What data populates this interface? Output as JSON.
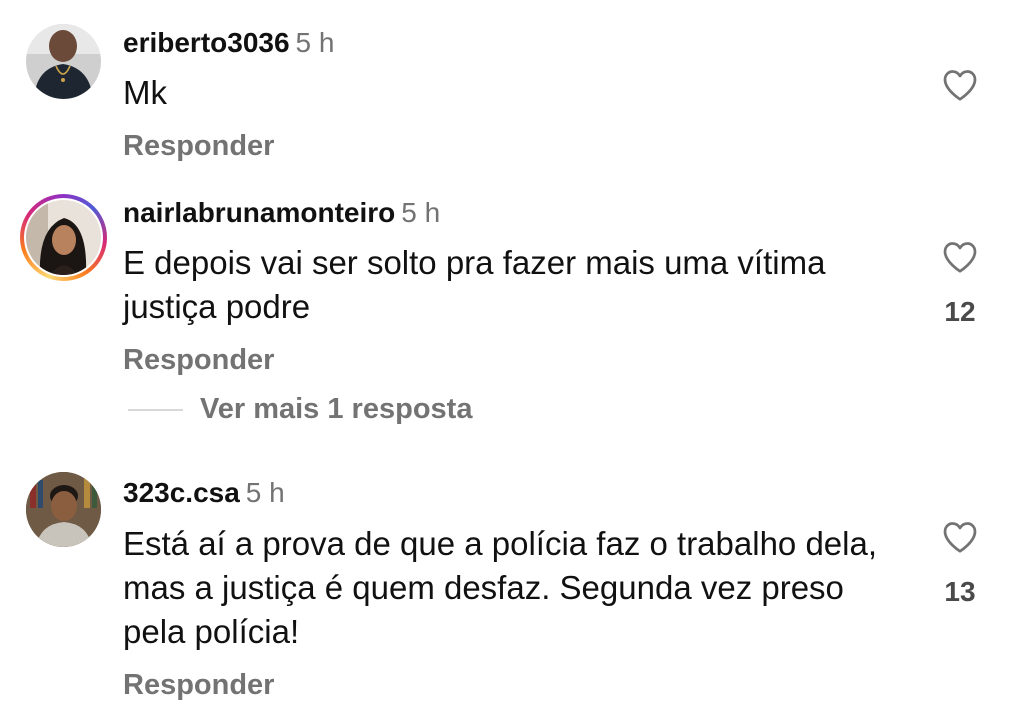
{
  "comments": [
    {
      "username": "eriberto3036",
      "time": "5 h",
      "text": "Mk",
      "reply_label": "Responder",
      "like_count": ""
    },
    {
      "username": "nairlabrunamonteiro",
      "time": "5 h",
      "text": "E depois vai ser solto pra fazer mais uma vítima  justiça podre",
      "reply_label": "Responder",
      "like_count": "12",
      "more_replies_label": "Ver mais 1 resposta"
    },
    {
      "username": "323c.csa",
      "time": "5 h",
      "text": "Está aí a prova de que a polícia faz o trabalho dela, mas a justiça é quem desfaz. Segunda vez preso pela polícia!",
      "reply_label": "Responder",
      "like_count": "13"
    }
  ],
  "icons": {
    "like": "heart-outline-icon"
  },
  "colors": {
    "primary_text": "#111111",
    "secondary_text": "#737373",
    "like_count": "#4a4a4a",
    "story_ring": [
      "#feda75",
      "#fa7e1e",
      "#d62976",
      "#962fbf",
      "#4f5bd5"
    ]
  }
}
